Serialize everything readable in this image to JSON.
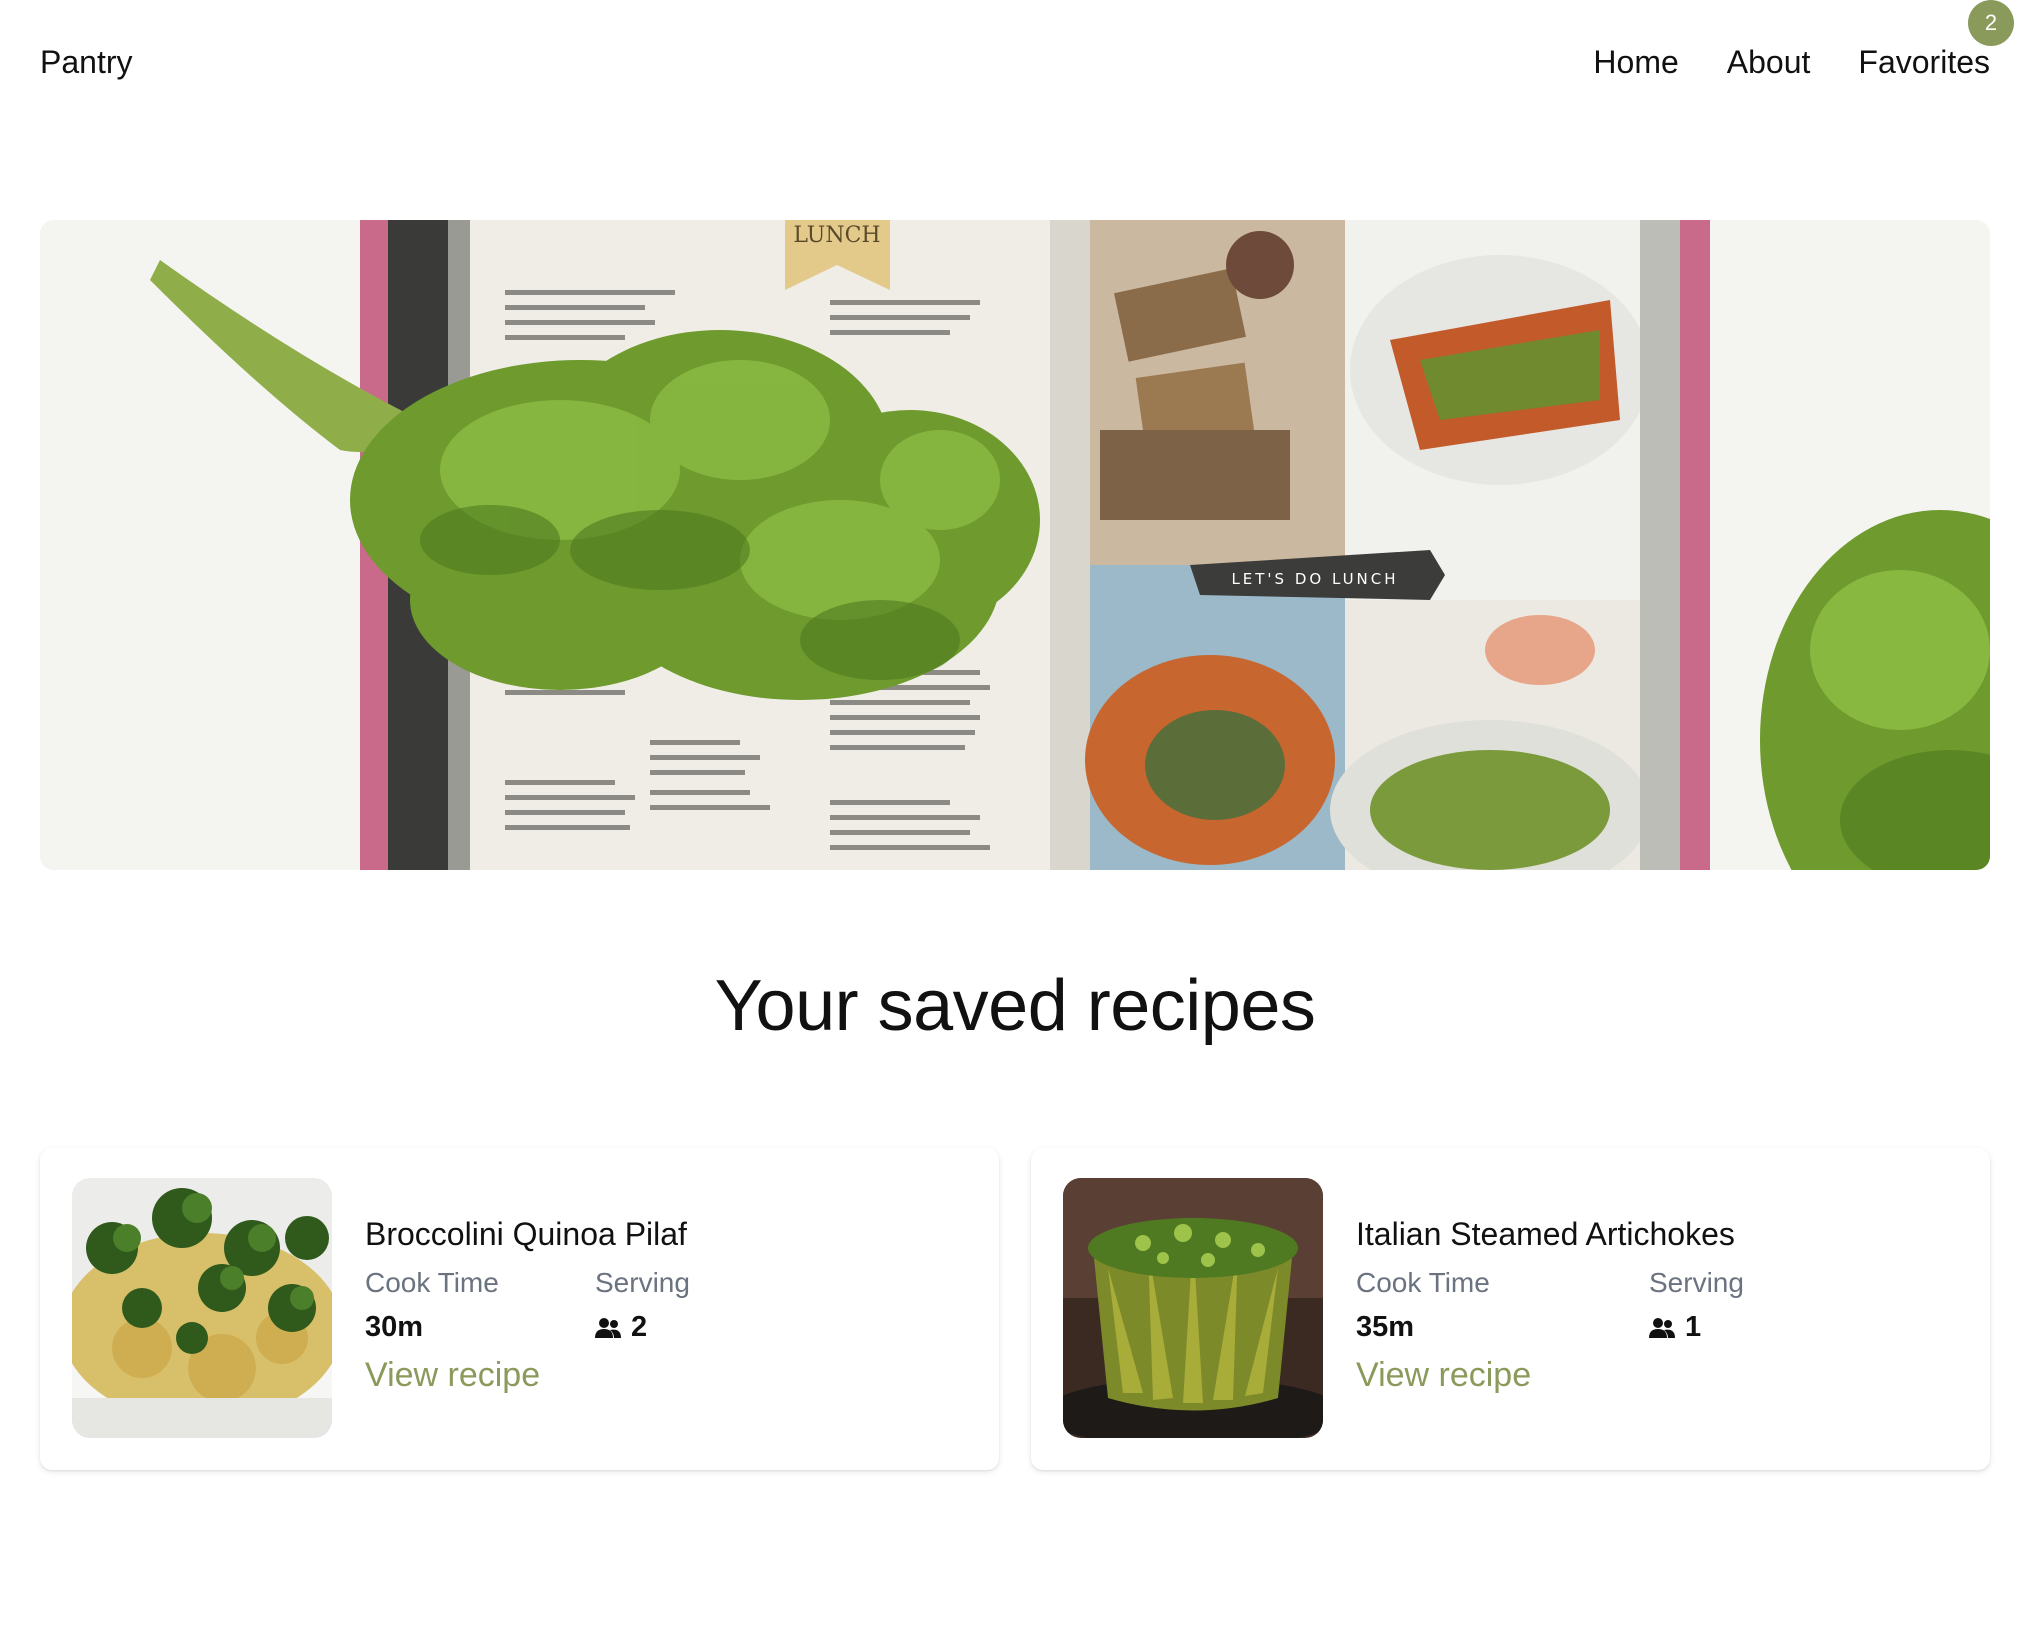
{
  "header": {
    "brand": "Pantry",
    "nav": [
      {
        "label": "Home"
      },
      {
        "label": "About"
      },
      {
        "label": "Favorites",
        "badge": "2"
      }
    ]
  },
  "hero": {
    "image_description": "open cookbook with curly kale",
    "book_text": {
      "left_heading": "LUNCH",
      "banner": "LET'S DO LUNCH"
    }
  },
  "main": {
    "title": "Your saved recipes",
    "recipes": [
      {
        "title": "Broccolini Quinoa Pilaf",
        "cook_time_label": "Cook Time",
        "cook_time": "30m",
        "serving_label": "Serving",
        "serving": "2",
        "link": "View recipe"
      },
      {
        "title": "Italian Steamed Artichokes",
        "cook_time_label": "Cook Time",
        "cook_time": "35m",
        "serving_label": "Serving",
        "serving": "1",
        "link": "View recipe"
      }
    ]
  },
  "colors": {
    "accent": "#8a9a5b",
    "muted_text": "#6b7280",
    "text": "#111111"
  },
  "icons": {
    "serving": "people-icon"
  }
}
